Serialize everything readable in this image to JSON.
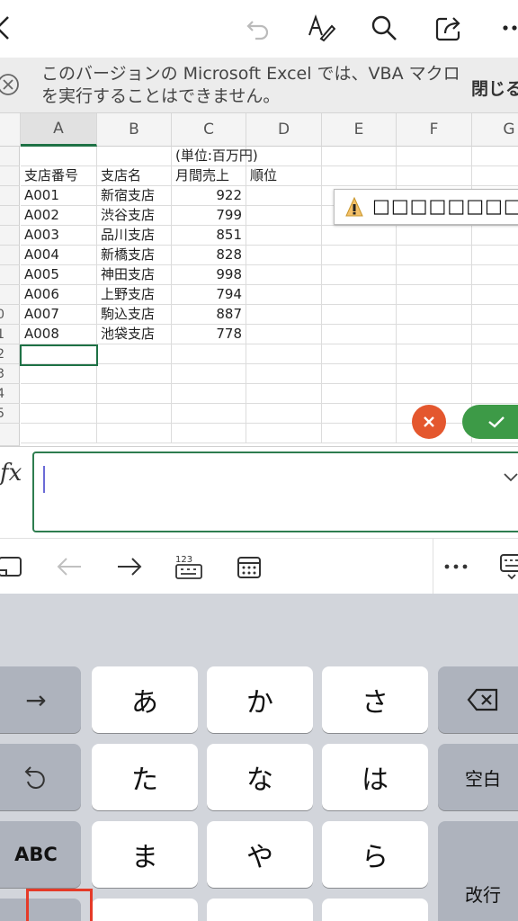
{
  "toolbar": {
    "icons": [
      "back-chevron-icon",
      "undo-icon",
      "pen-icon",
      "search-icon",
      "share-icon",
      "more-icon"
    ]
  },
  "banner": {
    "message": "このバージョンの Microsoft Excel では、VBA マクロを実行することはできません。",
    "close_label": "閉じる"
  },
  "grid": {
    "columns": [
      "A",
      "B",
      "C",
      "D",
      "E",
      "F",
      "G"
    ],
    "rows": [
      "",
      "",
      "",
      "",
      "",
      "",
      "",
      "",
      "0",
      "1",
      "2",
      "3",
      "4",
      "5"
    ],
    "unit_note": "(単位:百万円)",
    "headers": [
      "支店番号",
      "支店名",
      "月間売上",
      "順位"
    ],
    "data": [
      [
        "A001",
        "新宿支店",
        "922"
      ],
      [
        "A002",
        "渋谷支店",
        "799"
      ],
      [
        "A003",
        "品川支店",
        "851"
      ],
      [
        "A004",
        "新橋支店",
        "828"
      ],
      [
        "A005",
        "神田支店",
        "998"
      ],
      [
        "A006",
        "上野支店",
        "794"
      ],
      [
        "A007",
        "駒込支店",
        "887"
      ],
      [
        "A008",
        "池袋支店",
        "778"
      ]
    ],
    "popup_text": "□□□□□□□□□"
  },
  "formula_bar": {
    "label": "fx",
    "value": ""
  },
  "keyboard": {
    "kana_rows": [
      [
        "あ",
        "か",
        "さ"
      ],
      [
        "た",
        "な",
        "は"
      ],
      [
        "ま",
        "や",
        "ら"
      ]
    ],
    "left_keys": [
      "→",
      "ABC"
    ],
    "space_label": "空白",
    "enter_label": "改行"
  },
  "colors": {
    "accent_green": "#1e7145",
    "cancel_orange": "#e4572e",
    "confirm_green": "#3d9a47",
    "highlight_red": "#e53a28"
  }
}
